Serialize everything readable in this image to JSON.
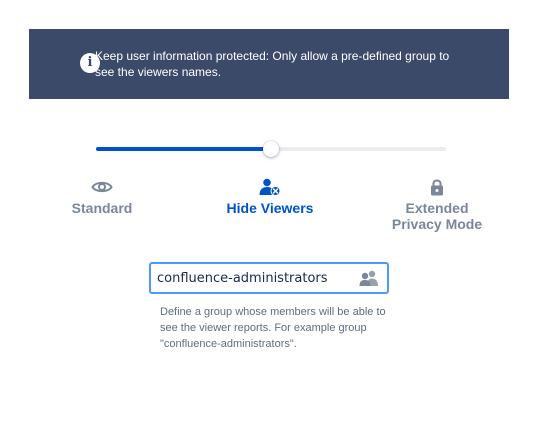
{
  "banner": {
    "icon": "info-icon",
    "icon_glyph": "i",
    "text": "Keep user information protected: Only allow a pre-defined group to see the viewers names.",
    "background": "#3b4a68"
  },
  "privacy_slider": {
    "levels": [
      {
        "label": "Standard",
        "icon": "eye-icon"
      },
      {
        "label": "Hide Viewers",
        "icon": "user-hidden-icon"
      },
      {
        "label": "Extended Privacy Mode",
        "icon": "lock-icon"
      }
    ],
    "selected_index": 1,
    "position_fraction": 0.5,
    "accent_color": "#0052cc",
    "inactive_color": "#7a869a"
  },
  "group_input": {
    "value": "confluence-administrators",
    "icon": "group-icon",
    "help": "Define a group whose members will be able to see the viewer reports. For example group \"confluence-administrators\"."
  }
}
